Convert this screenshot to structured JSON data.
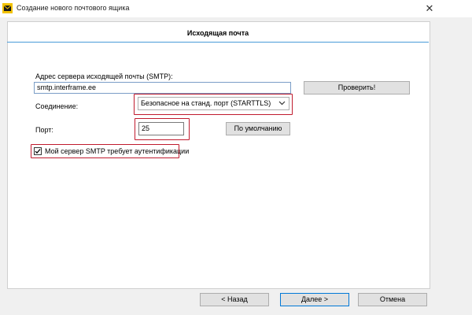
{
  "window": {
    "title": "Создание нового почтового ящика",
    "close_glyph": "✕"
  },
  "header": {
    "title": "Исходящая почта"
  },
  "form": {
    "smtp_label": "Адрес сервера исходящей почты (SMTP):",
    "smtp_value": "smtp.interframe.ee",
    "check_button": "Проверить!",
    "connection_label": "Соединение:",
    "connection_value": "Безопасное на станд. порт (STARTTLS)",
    "port_label": "Порт:",
    "port_value": "25",
    "default_button": "По умолчанию",
    "auth_checkbox_label": "Мой сервер SMTP требует аутентификации",
    "auth_checked": true
  },
  "footer": {
    "back_button": "<  Назад",
    "next_button": "Далее  >",
    "cancel_button": "Отмена"
  },
  "colors": {
    "highlight": "#c01b2e",
    "header_line": "#4a9bd8",
    "primary_button_border": "#0078d7"
  }
}
